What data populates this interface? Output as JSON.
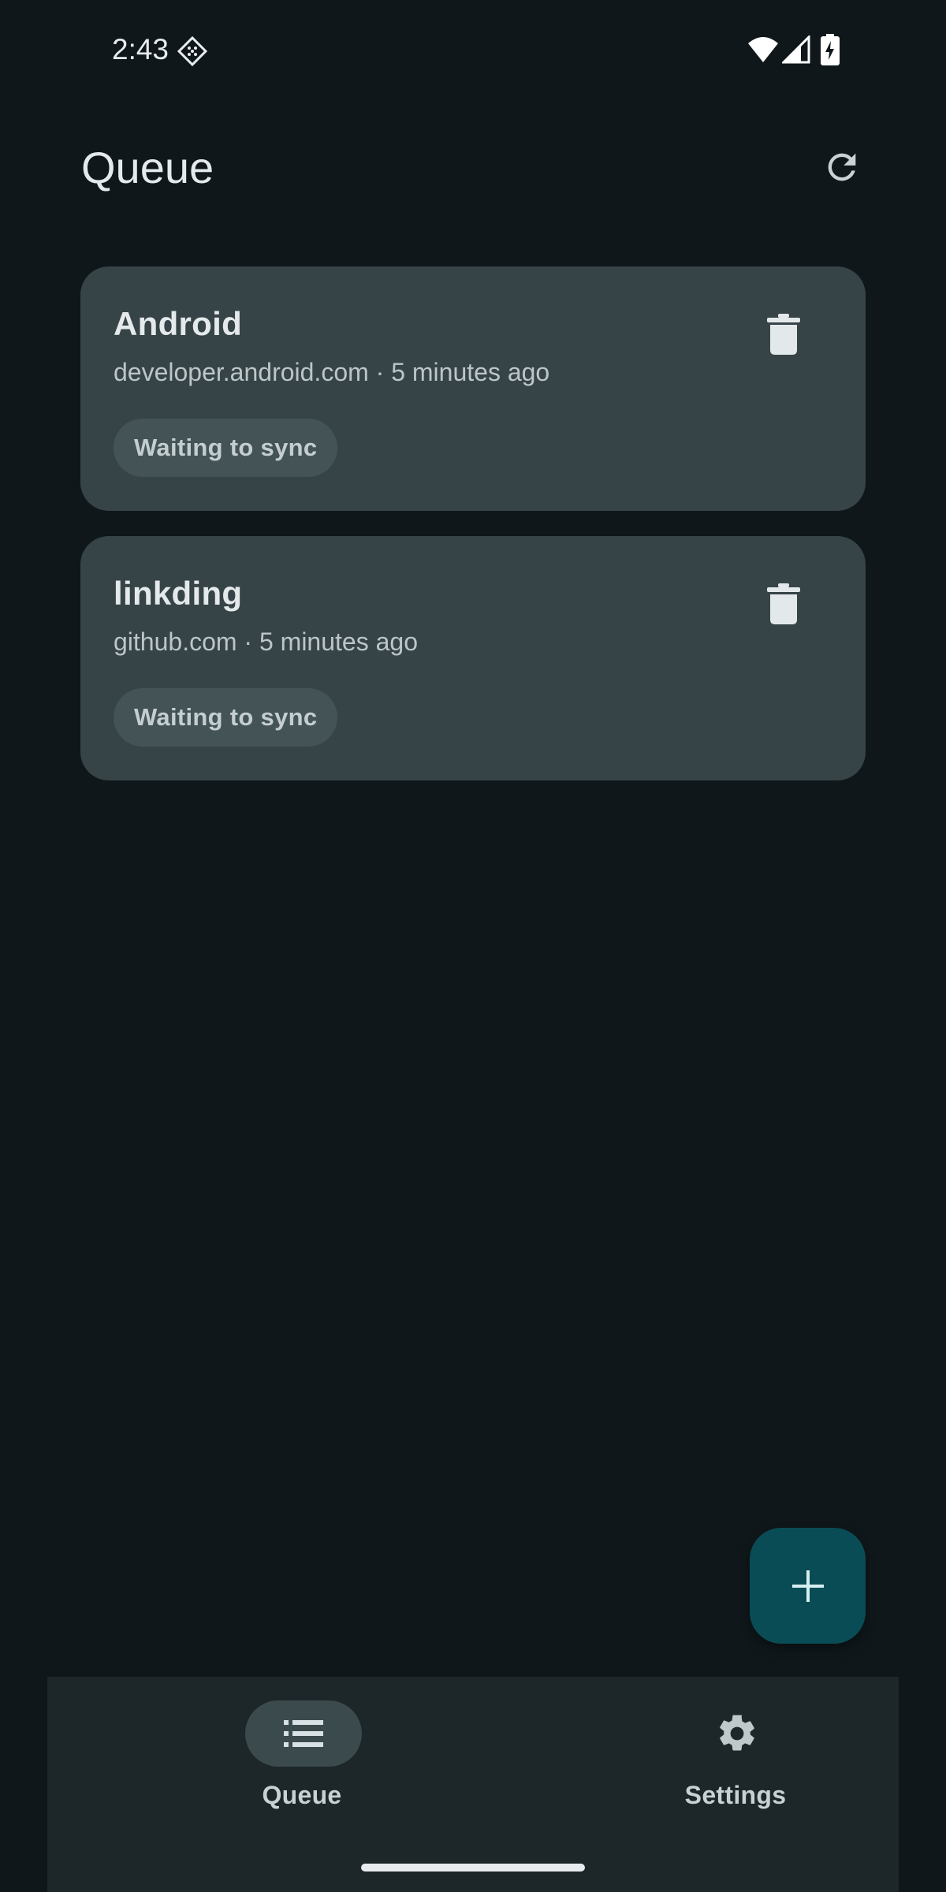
{
  "status_bar": {
    "time": "2:43"
  },
  "header": {
    "title": "Queue",
    "refresh_icon": "refresh-icon"
  },
  "queue": {
    "items": [
      {
        "title": "Android",
        "subtitle": "developer.android.com · 5 minutes ago",
        "status": "Waiting to sync",
        "delete_icon": "trash-icon"
      },
      {
        "title": "linkding",
        "subtitle": "github.com · 5 minutes ago",
        "status": "Waiting to sync",
        "delete_icon": "trash-icon"
      }
    ]
  },
  "fab": {
    "icon": "plus-icon"
  },
  "bottom_nav": {
    "items": [
      {
        "label": "Queue",
        "icon": "list-icon",
        "selected": true
      },
      {
        "label": "Settings",
        "icon": "gear-icon",
        "selected": false
      }
    ]
  },
  "colors": {
    "background": "#0f171a",
    "card": "#374447",
    "chip": "#445356",
    "fab": "#0a4c55",
    "nav_bar": "#1d2629",
    "nav_indicator": "#3b4a4d"
  }
}
